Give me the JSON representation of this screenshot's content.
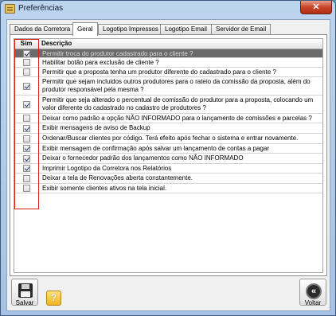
{
  "window": {
    "title": "Preferências",
    "close_glyph": "✕",
    "icon": "app-icon"
  },
  "tabs": [
    {
      "label": "Dados da Corretora",
      "active": false
    },
    {
      "label": "Geral",
      "active": true
    },
    {
      "label": "Logotipo Impressos",
      "active": false
    },
    {
      "label": "Logotipo Email",
      "active": false
    },
    {
      "label": "Servidor de Email",
      "active": false
    }
  ],
  "grid": {
    "columns": {
      "sim": "Sim",
      "descricao": "Descrição"
    },
    "rows": [
      {
        "checked": true,
        "selected": true,
        "text": "Permitir troca do produtor cadastrado para o cliente ?"
      },
      {
        "checked": false,
        "selected": false,
        "text": "Habilitar botão para exclusão de cliente ?"
      },
      {
        "checked": false,
        "selected": false,
        "text": "Permitir que a proposta tenha um produtor diferente do cadastrado para o cliente ?"
      },
      {
        "checked": true,
        "selected": false,
        "text": "Permitir que sejam incluidos outros produtores para o rateio da comissão da proposta, além do produtor responsável pela mesma ?"
      },
      {
        "checked": true,
        "selected": false,
        "text": "Permitir que seja alterado o percentual de comissão do produtor para a proposta, colocando um valor diferente do cadastrado no cadastro de produtores ?"
      },
      {
        "checked": false,
        "selected": false,
        "text": "Deixar como padrão a opção NÃO INFORMADO para o lançamento de comissões e parcelas ?"
      },
      {
        "checked": true,
        "selected": false,
        "text": "Exibir mensagens de aviso de Backup"
      },
      {
        "checked": false,
        "selected": false,
        "text": "Ordenar/Buscar clientes por código. Terá efeito após fechar o sistema e entrar novamente."
      },
      {
        "checked": true,
        "selected": false,
        "text": "Exibir mensagem de confirmação após salvar um lançamento de contas a pagar"
      },
      {
        "checked": true,
        "selected": false,
        "text": "Deixar o fornecedor padrão dos lançamentos como NÃO INFORMADO"
      },
      {
        "checked": true,
        "selected": false,
        "text": "Imprimir Logotipo da Corretora nos Relatórios"
      },
      {
        "checked": false,
        "selected": false,
        "text": "Deixar a tela de Renovações aberta constantemente."
      },
      {
        "checked": false,
        "selected": false,
        "text": "Exibir somente clientes ativos na tela inicial."
      }
    ]
  },
  "buttons": {
    "salvar": "Salvar",
    "voltar": "Voltar",
    "help_glyph": "?",
    "back_glyph": "«"
  },
  "colors": {
    "selected_row": "#6b6b6b",
    "highlight_border": "#d81d1d"
  }
}
